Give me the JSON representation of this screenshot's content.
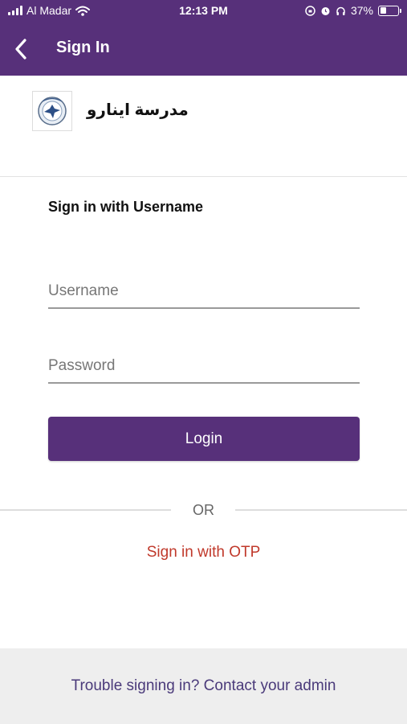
{
  "status_bar": {
    "carrier": "Al Madar",
    "time": "12:13 PM",
    "battery_percent": "37%",
    "battery_level": 0.37,
    "icons": [
      "signal-icon",
      "wifi-icon",
      "screen-lock-icon",
      "alarm-icon",
      "headphones-icon",
      "battery-icon"
    ]
  },
  "app_bar": {
    "title": "Sign In",
    "back_icon": "chevron-left-icon",
    "background_color": "#57307a"
  },
  "school": {
    "name": "مدرسة اينارو",
    "logo_icon": "school-crest-icon"
  },
  "form": {
    "section_title": "Sign in with Username",
    "username": {
      "value": "",
      "placeholder": "Username"
    },
    "password": {
      "value": "",
      "placeholder": "Password"
    },
    "login_label": "Login"
  },
  "divider": {
    "label": "OR"
  },
  "otp": {
    "label": "Sign in with OTP",
    "color": "#c0392b"
  },
  "footer": {
    "label": "Trouble signing in? Contact your admin"
  },
  "colors": {
    "accent": "#57307a",
    "footer_bg": "#eeeeee"
  }
}
